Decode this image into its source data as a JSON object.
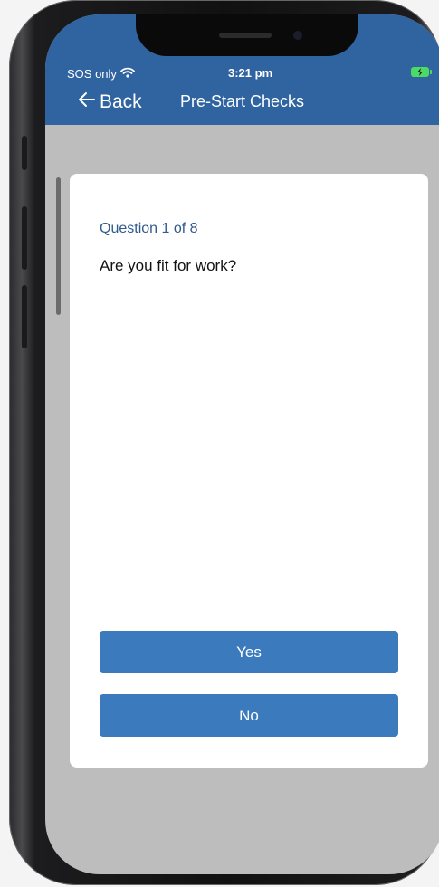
{
  "status_bar": {
    "carrier": "SOS only",
    "time": "3:21 pm"
  },
  "nav": {
    "back_label": "Back",
    "title": "Pre-Start Checks"
  },
  "question": {
    "counter": "Question 1 of 8",
    "text": "Are you fit for work?"
  },
  "answers": {
    "yes_label": "Yes",
    "no_label": "No"
  },
  "colors": {
    "header": "#2f64a0",
    "button": "#3b7abd",
    "counter_text": "#2f5a8c",
    "battery": "#4cd964"
  },
  "icons": [
    "wifi-icon",
    "battery-charging-icon",
    "back-arrow-icon"
  ]
}
